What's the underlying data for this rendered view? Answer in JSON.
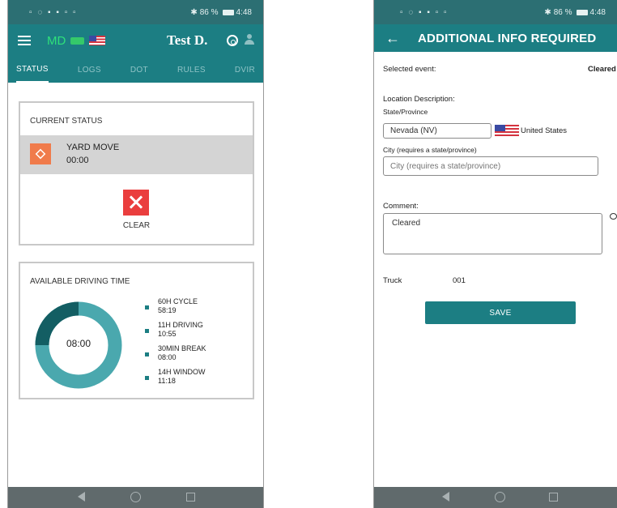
{
  "colors": {
    "statusbar": "#2c6f73",
    "primary": "#1c7e83",
    "accent_orange": "#f07b4b",
    "clear_red": "#ea3e3e",
    "donut_light": "#4aa8ae",
    "donut_dark": "#135e63",
    "navbar": "#606a6c"
  },
  "status_bar": {
    "time": "4:48",
    "battery": "86 %"
  },
  "screen1": {
    "header": {
      "state": "MD",
      "driver_name": "Test D."
    },
    "tabs": [
      {
        "label": "STATUS",
        "active": true
      },
      {
        "label": "LOGS",
        "active": false
      },
      {
        "label": "DOT",
        "active": false
      },
      {
        "label": "RULES",
        "active": false
      },
      {
        "label": "DVIR",
        "active": false
      }
    ],
    "current_status": {
      "title": "CURRENT STATUS",
      "status_name": "YARD MOVE",
      "status_time": "00:00",
      "icon": "package-icon",
      "clear_label": "CLEAR"
    },
    "available_driving": {
      "title": "AVAILABLE DRIVING TIME",
      "donut_value": "08:00",
      "items": [
        {
          "label": "60H CYCLE",
          "value": "58:19"
        },
        {
          "label": "11H DRIVING",
          "value": "10:55"
        },
        {
          "label": "30MIN BREAK",
          "value": "08:00"
        },
        {
          "label": "14H WINDOW",
          "value": "11:18"
        }
      ]
    }
  },
  "screen2": {
    "title": "ADDITIONAL INFO REQUIRED",
    "selected_event_label": "Selected event:",
    "selected_event_value": "Cleared",
    "location_label": "Location Description:",
    "state_label": "State/Province",
    "state_value": "Nevada (NV)",
    "country": "United States",
    "city_label": "City (requires a state/province)",
    "city_placeholder": "City (requires a state/province)",
    "comment_label": "Comment:",
    "comment_value": "Cleared",
    "truck_label": "Truck",
    "truck_value": "001",
    "save_label": "SAVE"
  }
}
